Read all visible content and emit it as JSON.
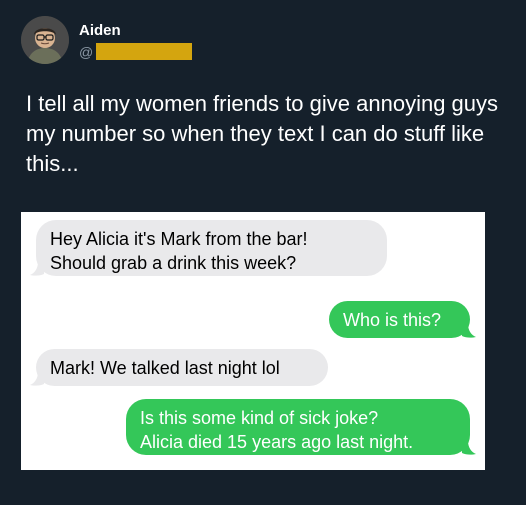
{
  "tweet": {
    "author_name": "Aiden",
    "handle_prefix": "@",
    "text": "I tell all my women friends to give annoying guys my number so when they text I can do stuff like this..."
  },
  "messages": [
    {
      "side": "received",
      "lines": [
        "Hey Alicia it's Mark from the bar!",
        "Should grab a drink this week?"
      ]
    },
    {
      "side": "sent",
      "lines": [
        "Who is this?"
      ]
    },
    {
      "side": "received",
      "lines": [
        "Mark! We talked last night lol"
      ]
    },
    {
      "side": "sent",
      "lines": [
        "Is this some kind of sick joke?",
        "Alicia died 15 years ago last night."
      ]
    }
  ],
  "colors": {
    "background": "#15202b",
    "received_bubble": "#e9e9eb",
    "sent_bubble": "#34c759",
    "handle_redaction": "#d4a50f"
  }
}
